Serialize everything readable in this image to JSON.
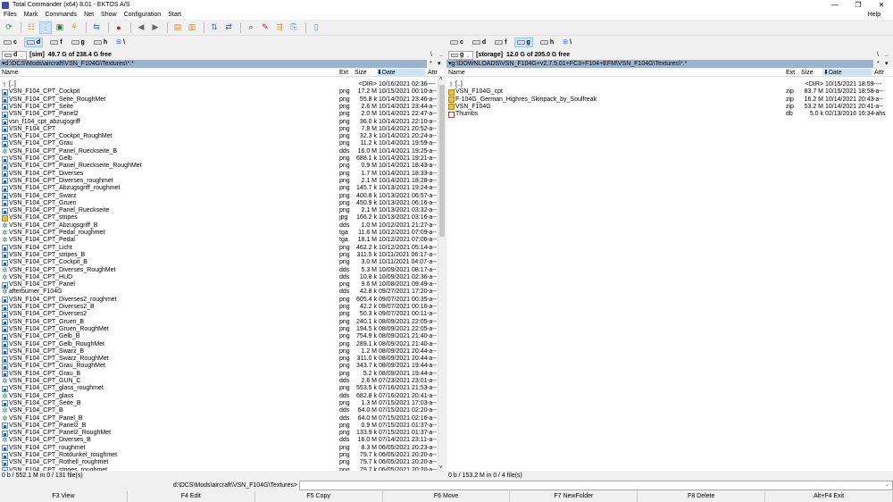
{
  "title": "Total Commander (x64) 8.01 - EKTOS A/S",
  "window_buttons": [
    "—",
    "❐",
    "✕"
  ],
  "menu": [
    "Files",
    "Mark",
    "Commands",
    "Net",
    "Show",
    "Configuration",
    "Start"
  ],
  "menu_help": "Help",
  "drives": [
    "c",
    "d",
    "f",
    "g",
    "h",
    "\\"
  ],
  "left": {
    "drive": "d",
    "volume": "[sim]",
    "free": "49.7 G of 238.4 G free",
    "path": "▾d:\\DCS\\Mods\\aircraft\\VSN_F104G\\Textures\\*.*",
    "headers": {
      "name": "Name",
      "ext": "Ext",
      "size": "Size",
      "date": "⬇Date",
      "attr": "Attr"
    },
    "rows": [
      [
        "[..]",
        "",
        "<DIR>",
        "10/16/2021 02:36",
        "----",
        "up"
      ],
      [
        "VSN_F104_CPT_Cockpit",
        "png",
        "17.2 M",
        "10/15/2021 00:10",
        "-a--",
        "png"
      ],
      [
        "VSN_F104_CPT_Seite_RoughMet",
        "png",
        "55.8 k",
        "10/14/2021 23:46",
        "-a--",
        "png"
      ],
      [
        "VSN_F104_CPT_Seite",
        "png",
        "2.6 M",
        "10/14/2021 23:44",
        "-a--",
        "png"
      ],
      [
        "VSN_F104_CPT_Panel2",
        "png",
        "2.0 M",
        "10/14/2021 22:47",
        "-a--",
        "png"
      ],
      [
        "vsn_f104_cpt_abzugsgriff",
        "png",
        "36.0 k",
        "10/14/2021 22:10",
        "-a--",
        "png"
      ],
      [
        "VSN_F104_CPT",
        "png",
        "7.8 M",
        "10/14/2021 20:52",
        "-a--",
        "png"
      ],
      [
        "VSN_F104_CPT_Cockpit_RoughMet",
        "png",
        "32.3 k",
        "10/14/2021 20:24",
        "-a--",
        "png"
      ],
      [
        "VSN_F104_CPT_Grau",
        "png",
        "11.2 k",
        "10/14/2021 19:59",
        "-a--",
        "png"
      ],
      [
        "VSN_F104_CPT_Panel_Rueckseite_B",
        "dds",
        "16.0 M",
        "10/14/2021 19:25",
        "-a--",
        "dds"
      ],
      [
        "VSN_F104_CPT_Gelb",
        "png",
        "688.1 k",
        "10/14/2021 19:21",
        "-a--",
        "png"
      ],
      [
        "VSN_F104_CPT_Panel_Rueckseite_RoughMet",
        "png",
        "0.9 M",
        "10/14/2021 18:43",
        "-a--",
        "png"
      ],
      [
        "VSN_F104_CPT_Diverses",
        "png",
        "1.7 M",
        "10/14/2021 18:33",
        "-a--",
        "png"
      ],
      [
        "VSN_F104_CPT_Diverses_roughmet",
        "png",
        "2.1 M",
        "10/14/2021 18:28",
        "-a--",
        "png"
      ],
      [
        "VSN_F104_CPT_Abzugsgriff_roughmet",
        "png",
        "145.7 k",
        "10/13/2021 19:24",
        "-a--",
        "png"
      ],
      [
        "VSN_F104_CPT_Swarz",
        "png",
        "400.8 k",
        "10/13/2021 06:57",
        "-a--",
        "png"
      ],
      [
        "VSN_F104_CPT_Gruen",
        "png",
        "450.9 k",
        "10/13/2021 06:16",
        "-a--",
        "png"
      ],
      [
        "VSN_F104_CPT_Panel_Rueckseite",
        "png",
        "2.1 M",
        "10/13/2021 03:32",
        "-a--",
        "png"
      ],
      [
        "VSN_F104_CPT_stripes",
        "jpg",
        "166.2 k",
        "10/13/2021 03:16",
        "-a--",
        "jpg"
      ],
      [
        "VSN_F104_CPT_Abzugsgriff_B",
        "dds",
        "1.0 M",
        "10/12/2021 21:27",
        "-a--",
        "dds"
      ],
      [
        "VSN_F104_CPT_Pedal_roughmet",
        "tga",
        "11.6 M",
        "10/12/2021 07:09",
        "-a--",
        "dds"
      ],
      [
        "VSN_F104_CPT_Pedal",
        "tga",
        "18.1 M",
        "10/12/2021 07:06",
        "-a--",
        "dds"
      ],
      [
        "VSN_F104_CPT_Licht",
        "png",
        "462.2 k",
        "10/12/2021 05:14",
        "-a--",
        "png"
      ],
      [
        "VSN_F104_CPT_stripes_B",
        "png",
        "311.5 k",
        "10/11/2021 06:17",
        "-a--",
        "png"
      ],
      [
        "VSN_F104_CPT_Cockpit_B",
        "png",
        "3.0 M",
        "10/11/2021 04:07",
        "-a--",
        "png"
      ],
      [
        "VSN_F104_CPT_Diverses_RoughMet",
        "dds",
        "5.3 M",
        "10/09/2021 08:17",
        "-a--",
        "dds"
      ],
      [
        "VSN_F104_CPT_HUD",
        "dds",
        "10.8 k",
        "10/09/2021 02:36",
        "-a--",
        "dds"
      ],
      [
        "VSN_F104_CPT_Panel",
        "png",
        "9.6 M",
        "10/08/2021 09:49",
        "-a--",
        "png"
      ],
      [
        "afterburner_F104G",
        "dds",
        "42.8 k",
        "09/27/2021 17:20",
        "-a--",
        "dds"
      ],
      [
        "VSN_F104_CPT_Diverses2_roughmet",
        "png",
        "605.4 k",
        "09/07/2021 00:35",
        "-a--",
        "png"
      ],
      [
        "VSN_F104_CPT_Diverses2_B",
        "png",
        "42.2 k",
        "09/07/2021 00:16",
        "-a--",
        "png"
      ],
      [
        "VSN_F104_CPT_Diverses2",
        "png",
        "50.3 k",
        "09/07/2021 00:11",
        "-a--",
        "png"
      ],
      [
        "VSN_F104_CPT_Gruen_B",
        "png",
        "240.1 k",
        "08/09/2021 22:05",
        "-a--",
        "png"
      ],
      [
        "VSN_F104_CPT_Gruen_RoughMet",
        "png",
        "194.5 k",
        "08/09/2021 22:05",
        "-a--",
        "png"
      ],
      [
        "VSN_F104_CPT_Gelb_B",
        "png",
        "754.9 k",
        "08/09/2021 21:40",
        "-a--",
        "png"
      ],
      [
        "VSN_F104_CPT_Gelb_RoughMet",
        "png",
        "289.1 k",
        "08/09/2021 21:40",
        "-a--",
        "png"
      ],
      [
        "VSN_F104_CPT_Swarz_B",
        "png",
        "1.2 M",
        "08/09/2021 20:44",
        "-a--",
        "png"
      ],
      [
        "VSN_F104_CPT_Swarz_RoughMet",
        "png",
        "311.0 k",
        "08/09/2021 20:44",
        "-a--",
        "png"
      ],
      [
        "VSN_F104_CPT_Grau_RoughMet",
        "png",
        "343.7 k",
        "08/09/2021 19:44",
        "-a--",
        "png"
      ],
      [
        "VSN_F104_CPT_Grau_B",
        "png",
        "5.2 k",
        "08/09/2021 19:44",
        "-a--",
        "png"
      ],
      [
        "VSN_F104_CPT_GUN_C",
        "dds",
        "2.6 M",
        "07/23/2021 23:01",
        "-a--",
        "dds"
      ],
      [
        "VSN_F104_CPT_glass_roughmet",
        "png",
        "553.5 k",
        "07/16/2021 21:53",
        "-a--",
        "png"
      ],
      [
        "VSN_F104_CPT_glass",
        "dds",
        "682.8 k",
        "07/16/2021 20:41",
        "-a--",
        "dds"
      ],
      [
        "VSN_F104_CPT_Seite_B",
        "png",
        "1.3 M",
        "07/15/2021 17:03",
        "-a--",
        "png"
      ],
      [
        "VSN_F104_CPT_B",
        "dds",
        "64.0 M",
        "07/15/2021 02:20",
        "-a--",
        "dds"
      ],
      [
        "VSN_F104_CPT_Panel_B",
        "dds",
        "64.0 M",
        "07/15/2021 02:16",
        "-a--",
        "dds"
      ],
      [
        "VSN_F104_CPT_Panel2_B",
        "png",
        "0.9 M",
        "07/15/2021 01:37",
        "-a--",
        "png"
      ],
      [
        "VSN_F104_CPT_Panel2_RoughMet",
        "png",
        "133.9 k",
        "07/15/2021 01:37",
        "-a--",
        "png"
      ],
      [
        "VSN_F104_CPT_Diverses_B",
        "dds",
        "16.0 M",
        "07/14/2021 23:11",
        "-a--",
        "dds"
      ],
      [
        "VSN_F104_CPT_roughmet",
        "png",
        "8.3 M",
        "06/05/2021 20:23",
        "-a--",
        "png"
      ],
      [
        "VSN_F104_CPT_Rotdunkel_roughmet",
        "png",
        "79.7 k",
        "06/05/2021 20:20",
        "-a--",
        "png"
      ],
      [
        "VSN_F104_CPT_Rothell_roughmet",
        "png",
        "79.7 k",
        "06/05/2021 20:20",
        "-a--",
        "png"
      ],
      [
        "VSN_F104_CPT_stripes_roughmet",
        "png",
        "79.7 k",
        "06/05/2021 20:20",
        "-a--",
        "png"
      ]
    ],
    "status": "0 b / 552.1 M in 0 / 131 file(s)"
  },
  "right": {
    "drive": "g",
    "volume": "[storage]",
    "free": "12.0 G of 205.0 G free",
    "path": "▾g:\\DOWNLOADS\\VSN_F104G+v2.7.5.01+FC3+F104+EFM\\VSN_F104G\\Textures\\*.*",
    "headers": {
      "name": "Name",
      "ext": "Ext",
      "size": "Size",
      "date": "⬇Date",
      "attr": "Attr"
    },
    "rows": [
      [
        "[..]",
        "",
        "<DIR>",
        "10/15/2021 18:59",
        "----",
        "up"
      ],
      [
        "VSN_F104G_cpt",
        "zip",
        "83.7 M",
        "10/15/2021 18:58",
        "-a--",
        "zip"
      ],
      [
        "F-104G_German_Highres_Skinpack_by_Soulfreak",
        "zip",
        "16.2 M",
        "10/14/2021 20:43",
        "-a--",
        "zip"
      ],
      [
        "VSN_F104G",
        "zip",
        "53.2 M",
        "10/14/2021 20:41",
        "-a--",
        "zip"
      ],
      [
        "Thumbs",
        "db",
        "5.0 k",
        "02/13/2016 16:34",
        "-ahs",
        "db"
      ]
    ],
    "status": "0 b / 153.2 M in 0 / 4 file(s)"
  },
  "panel_buttons": {
    "root": "\\",
    "up": "..",
    "hist": "*",
    "dropdown": "▾"
  },
  "cmdline": {
    "label": "d:\\DCS\\Mods\\aircraft\\VSN_F104G\\Textures>",
    "value": ""
  },
  "fkeys": [
    "F3 View",
    "F4 Edit",
    "F5 Copy",
    "F6 Move",
    "F7 NewFolder",
    "F8 Delete",
    "Alt+F4 Exit"
  ]
}
